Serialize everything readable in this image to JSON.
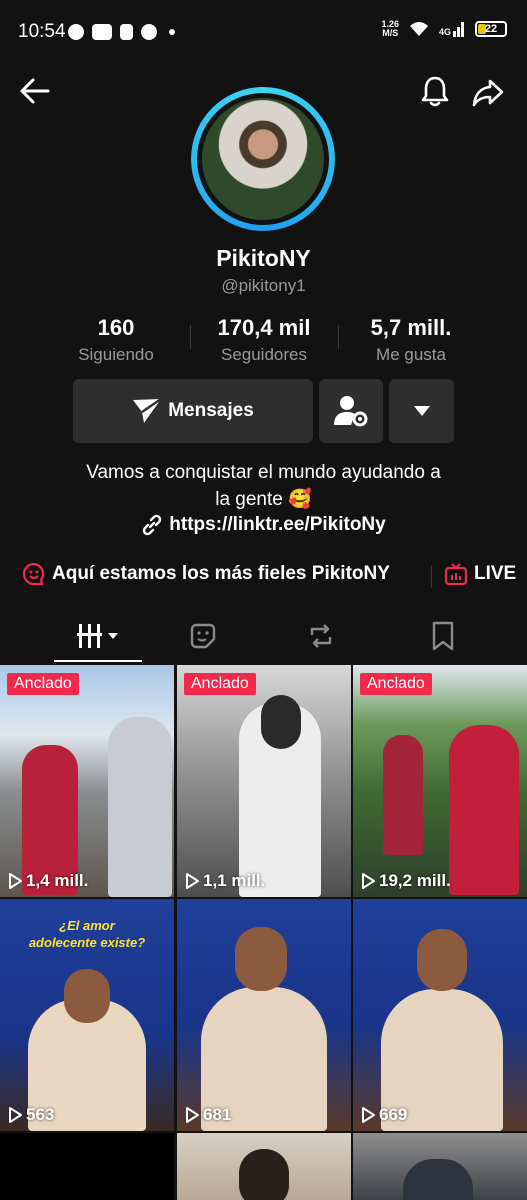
{
  "status": {
    "time": "10:54",
    "net_speed": "1.26",
    "net_unit": "M/S",
    "signal": "4G",
    "battery": "22"
  },
  "profile": {
    "name": "PikitoNY",
    "handle": "@pikitony1",
    "stats": [
      {
        "value": "160",
        "label": "Siguiendo"
      },
      {
        "value": "170,4 mil",
        "label": "Seguidores"
      },
      {
        "value": "5,7 mill.",
        "label": "Me gusta"
      }
    ],
    "message_button": "Mensajes",
    "bio_line1": "Vamos a conquistar el mundo ayudando a",
    "bio_line2": "la gente 🥰",
    "link": "https://linktr.ee/PikitoNy"
  },
  "highlights": {
    "group_label": "Aquí estamos los más fieles PikitoNY",
    "live_label": "LIVE"
  },
  "colors": {
    "accent": "#f2294d",
    "ring": "#3fd5f0",
    "background": "#121212",
    "button": "#2e2e2e"
  },
  "grid": [
    {
      "pinned": "Anclado",
      "views": "1,4 mill."
    },
    {
      "pinned": "Anclado",
      "views": "1,1 mill."
    },
    {
      "pinned": "Anclado",
      "views": "19,2 mill."
    },
    {
      "caption": "¿El amor adolecente existe?",
      "views": "563"
    },
    {
      "views": "681"
    },
    {
      "views": "669"
    }
  ]
}
